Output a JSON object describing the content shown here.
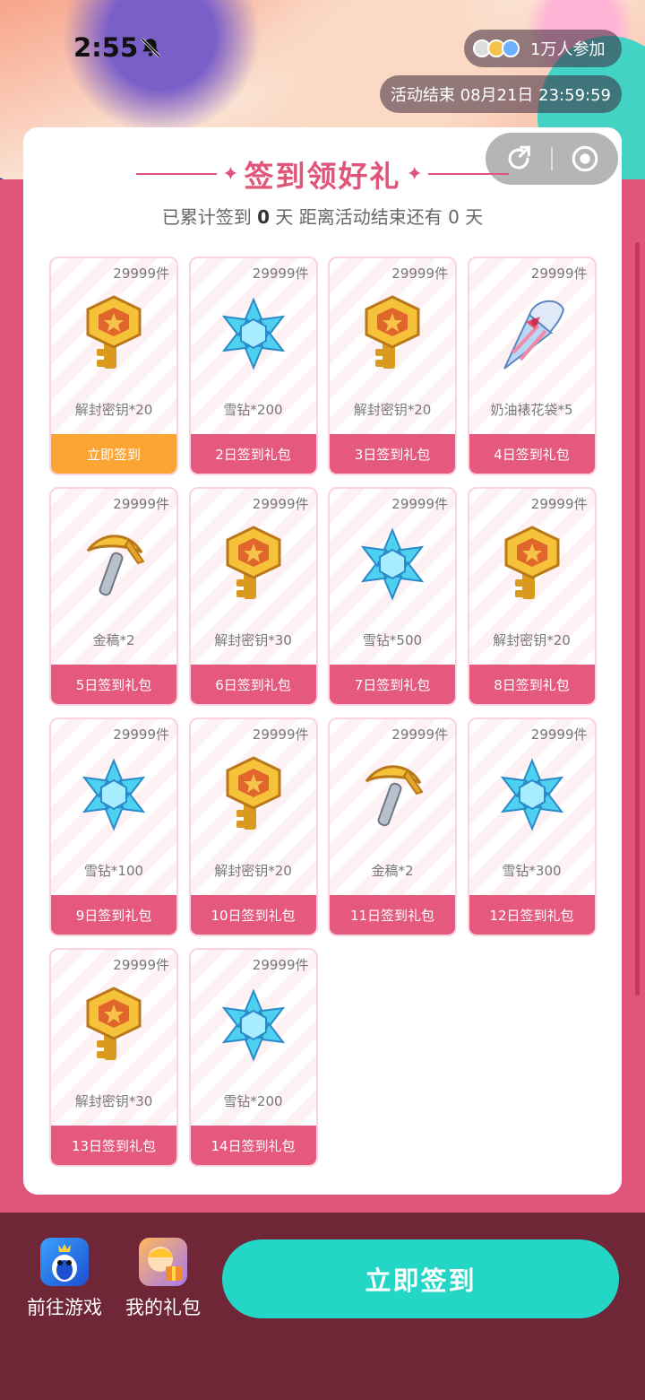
{
  "status": {
    "time": "2:55"
  },
  "banner": {
    "participants": "1万人参加",
    "end_time": "活动结束 08月21日 23:59:59"
  },
  "card": {
    "title": "签到领好礼",
    "subtitle_prefix": "已累计签到",
    "days_signed": "0",
    "subtitle_mid": "天  距离活动结束还有",
    "days_left": "0",
    "subtitle_suffix": "天"
  },
  "tiles": [
    {
      "stock": "29999件",
      "icon": "key-icon",
      "reward": "解封密钥*20",
      "cta": "立即签到",
      "active": true
    },
    {
      "stock": "29999件",
      "icon": "snowflake-icon",
      "reward": "雪钻*200",
      "cta": "2日签到礼包"
    },
    {
      "stock": "29999件",
      "icon": "key-icon",
      "reward": "解封密钥*20",
      "cta": "3日签到礼包"
    },
    {
      "stock": "29999件",
      "icon": "cone-icon",
      "reward": "奶油裱花袋*5",
      "cta": "4日签到礼包"
    },
    {
      "stock": "29999件",
      "icon": "pickaxe-icon",
      "reward": "金稿*2",
      "cta": "5日签到礼包"
    },
    {
      "stock": "29999件",
      "icon": "key-icon",
      "reward": "解封密钥*30",
      "cta": "6日签到礼包"
    },
    {
      "stock": "29999件",
      "icon": "snowflake-icon",
      "reward": "雪钻*500",
      "cta": "7日签到礼包"
    },
    {
      "stock": "29999件",
      "icon": "key-icon",
      "reward": "解封密钥*20",
      "cta": "8日签到礼包"
    },
    {
      "stock": "29999件",
      "icon": "snowflake-icon",
      "reward": "雪钻*100",
      "cta": "9日签到礼包"
    },
    {
      "stock": "29999件",
      "icon": "key-icon",
      "reward": "解封密钥*20",
      "cta": "10日签到礼包"
    },
    {
      "stock": "29999件",
      "icon": "pickaxe-icon",
      "reward": "金稿*2",
      "cta": "11日签到礼包"
    },
    {
      "stock": "29999件",
      "icon": "snowflake-icon",
      "reward": "雪钻*300",
      "cta": "12日签到礼包"
    },
    {
      "stock": "29999件",
      "icon": "key-icon",
      "reward": "解封密钥*30",
      "cta": "13日签到礼包"
    },
    {
      "stock": "29999件",
      "icon": "snowflake-icon",
      "reward": "雪钻*200",
      "cta": "14日签到礼包"
    }
  ],
  "bottom": {
    "game_label": "前往游戏",
    "gift_label": "我的礼包",
    "signin_label": "立即签到"
  },
  "colors": {
    "accent": "#e0557a",
    "active": "#fba535",
    "button": "#24d6c6",
    "footer": "#6f2738"
  }
}
